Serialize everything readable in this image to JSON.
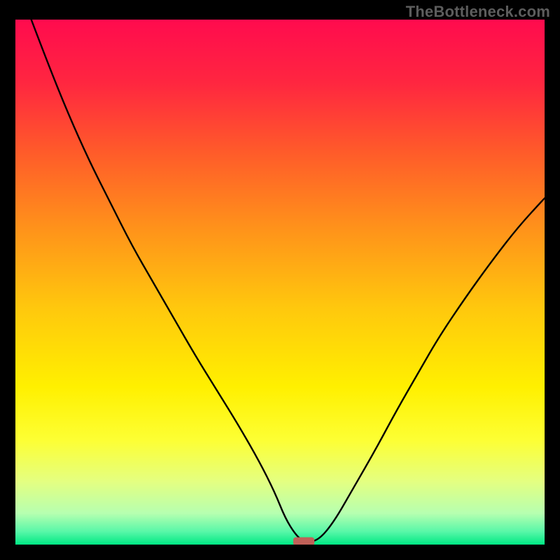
{
  "watermark": "TheBottleneck.com",
  "chart_data": {
    "type": "line",
    "title": "",
    "xlabel": "",
    "ylabel": "",
    "xlim": [
      0,
      100
    ],
    "ylim": [
      0,
      100
    ],
    "grid": false,
    "legend": false,
    "background": {
      "type": "vertical-gradient",
      "stops": [
        {
          "pos": 0.0,
          "color": "#ff0b4e"
        },
        {
          "pos": 0.12,
          "color": "#ff2640"
        },
        {
          "pos": 0.25,
          "color": "#ff5a2a"
        },
        {
          "pos": 0.4,
          "color": "#ff931a"
        },
        {
          "pos": 0.55,
          "color": "#ffc80d"
        },
        {
          "pos": 0.7,
          "color": "#fff000"
        },
        {
          "pos": 0.8,
          "color": "#fdff33"
        },
        {
          "pos": 0.88,
          "color": "#e4ff81"
        },
        {
          "pos": 0.94,
          "color": "#b7ffb0"
        },
        {
          "pos": 0.975,
          "color": "#59f7a8"
        },
        {
          "pos": 1.0,
          "color": "#00e884"
        }
      ]
    },
    "series": [
      {
        "name": "curve",
        "color": "#000000",
        "stroke_width": 2.4,
        "x": [
          3,
          6,
          10,
          14,
          18,
          22,
          26,
          30,
          34,
          38,
          42,
          46,
          49,
          51,
          53,
          54.5,
          57,
          60,
          64,
          68,
          72,
          76,
          80,
          85,
          90,
          95,
          100
        ],
        "y": [
          100,
          92,
          82,
          73,
          65,
          57,
          50,
          43,
          36,
          29.5,
          23,
          16,
          10,
          5,
          1.8,
          0.6,
          0.6,
          4,
          11,
          18,
          25.5,
          32.5,
          39.5,
          47,
          54,
          60.5,
          66
        ]
      }
    ],
    "markers": [
      {
        "name": "minimum-marker",
        "shape": "rounded-rect",
        "color": "#c06058",
        "cx": 54.5,
        "cy": 0.6,
        "w": 4.0,
        "h": 1.6
      }
    ]
  }
}
